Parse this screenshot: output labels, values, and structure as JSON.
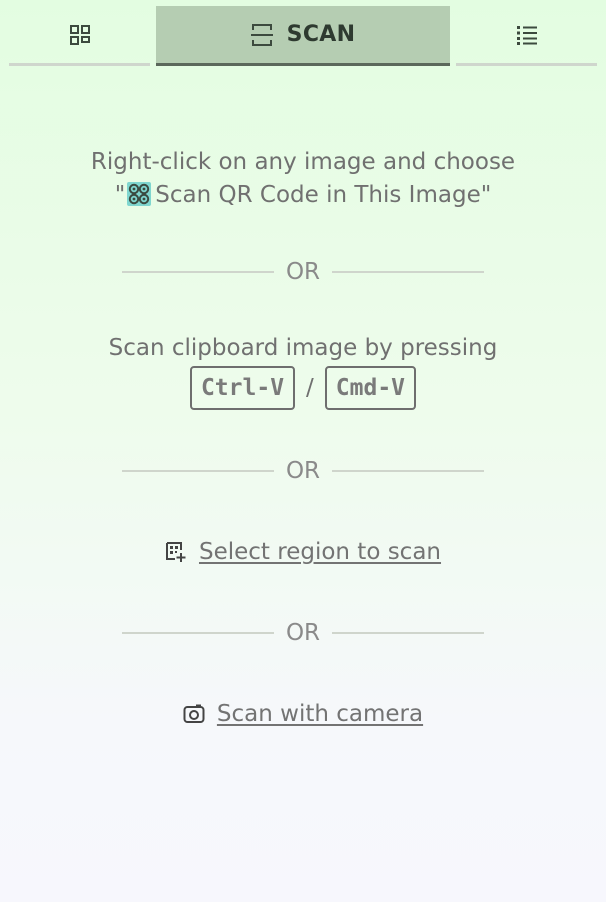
{
  "tabs": [
    {
      "icon": "qr-grid-icon",
      "label": ""
    },
    {
      "icon": "scan-icon",
      "label": "SCAN",
      "active": true
    },
    {
      "icon": "list-icon",
      "label": ""
    }
  ],
  "context_menu_hint": {
    "line1": "Right-click on any image and choose",
    "open_quote": "\"",
    "line2": "Scan QR Code in This Image",
    "close_quote": "\""
  },
  "separator_label": "OR",
  "clipboard": {
    "text": "Scan clipboard image by pressing",
    "key_windows": "Ctrl-V",
    "divider": "/",
    "key_mac": "Cmd-V"
  },
  "select_region": {
    "icon": "region-scan-icon",
    "label": "Select region to scan"
  },
  "camera": {
    "icon": "camera-icon",
    "label": "Scan with camera"
  },
  "colors": {
    "active_tab_bg": "#b5cdb2",
    "active_tab_border": "#5b685b",
    "text": "#707070",
    "bg_top": "#e3fde1",
    "bg_bottom": "#f7f7fd"
  }
}
